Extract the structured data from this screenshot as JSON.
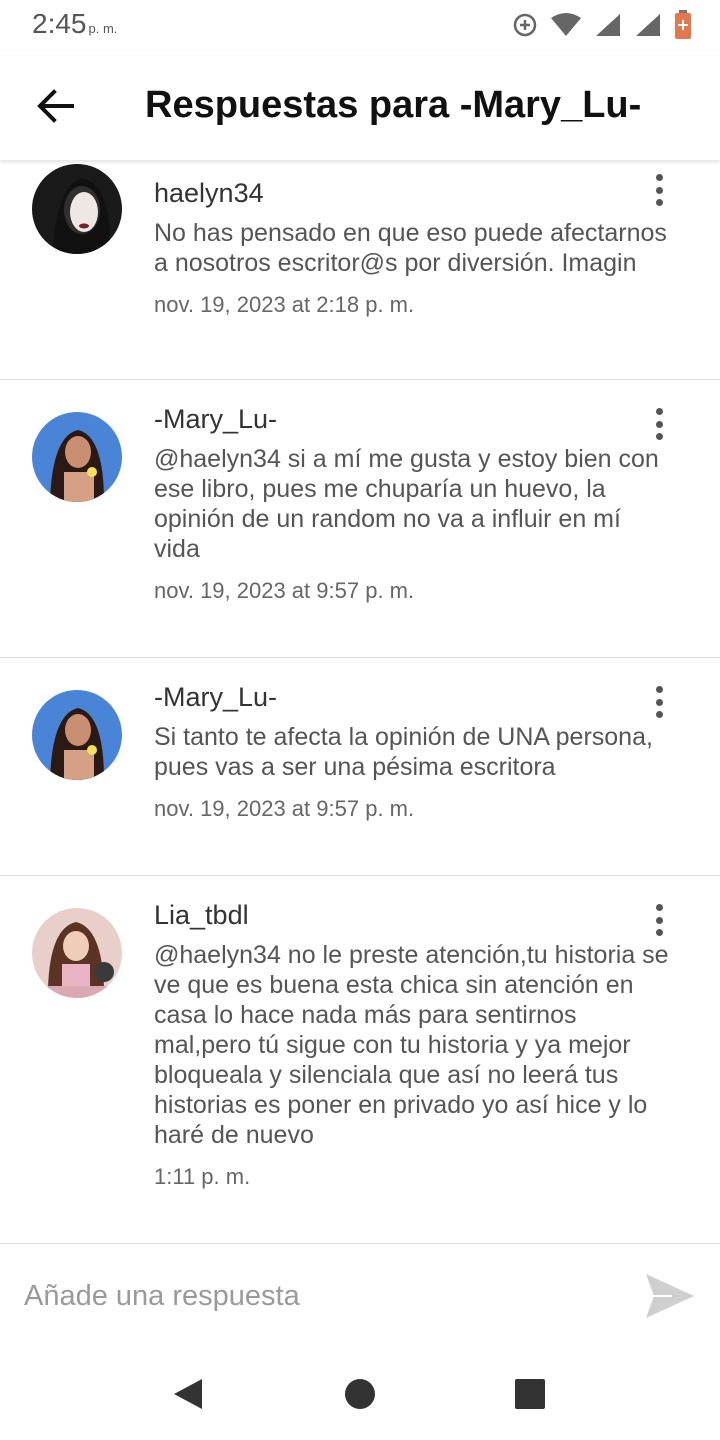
{
  "status_bar": {
    "time": "2:45",
    "ampm": "p. m.",
    "icons": [
      "data-saver-icon",
      "wifi-icon",
      "signal-icon",
      "signal-icon",
      "battery-icon"
    ]
  },
  "app_bar": {
    "title": "Respuestas para -Mary_Lu-",
    "back_icon": "arrow-left-icon"
  },
  "comments": [
    {
      "username": "haelyn34",
      "text": "No has pensado en que eso puede afectarnos a nosotros escritor@s por diversión. Imagin",
      "date": "nov. 19, 2023 at 2:18 p. m."
    },
    {
      "username": "-Mary_Lu-",
      "text": "@haelyn34  si a mí me gusta y estoy bien con ese libro, pues me chuparía un huevo, la opinión de un random no va a influir en mí vida",
      "date": "nov. 19, 2023 at 9:57 p. m."
    },
    {
      "username": "-Mary_Lu-",
      "text": "Si tanto te afecta la opinión de UNA persona, pues vas a ser una pésima escritora",
      "date": "nov. 19, 2023 at 9:57 p. m."
    },
    {
      "username": "Lia_tbdl",
      "text": "@haelyn34  no le preste atención,tu historia se ve que es buena esta chica sin atención en casa lo hace nada más para sentirnos mal,pero tú sigue con tu historia y ya mejor bloqueala y silenciala que así no leerá tus historias es poner en privado yo así hice y lo haré de nuevo",
      "date": "1:11 p. m."
    }
  ],
  "reply": {
    "placeholder": "Añade una respuesta",
    "send_icon": "send-icon"
  },
  "colors": {
    "divider": "#dcdcdc",
    "text_secondary": "#555555",
    "send": "#cfcfcf"
  }
}
